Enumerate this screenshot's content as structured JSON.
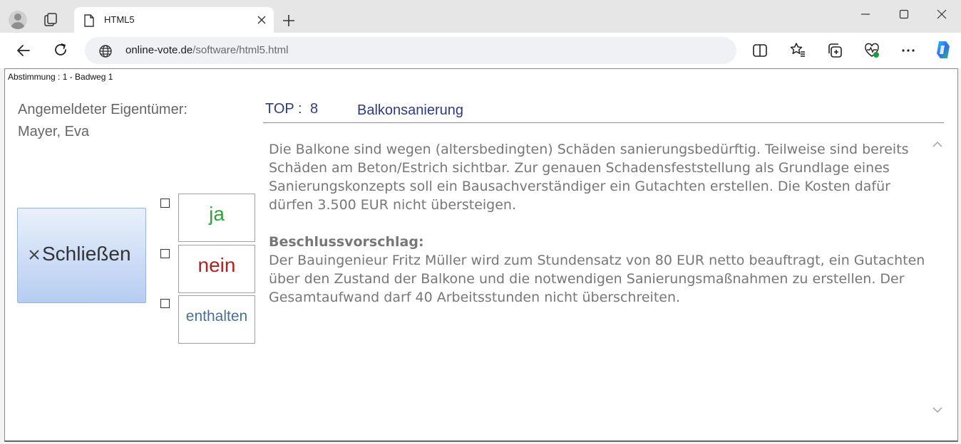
{
  "browser": {
    "tab_title": "HTML5",
    "url_host": "online-vote.de",
    "url_path": "/software/html5.html"
  },
  "page": {
    "header": "Abstimmung : 1 - Badweg 1",
    "owner_label": "Angemeldeter Eigentümer:",
    "owner_name": "Mayer, Eva",
    "close_label": "Schließen",
    "votes": {
      "yes": "ja",
      "no": "nein",
      "abstain": "enthalten"
    },
    "top_label": "TOP :",
    "top_number": "8",
    "top_title": "Balkonsanierung",
    "description": "Die Balkone sind wegen (altersbedingten) Schäden sanierungsbedürftig. Teilweise sind bereits Schäden am Beton/Estrich sichtbar. Zur genauen Schadensfeststellung als Grundlage eines Sanierungskonzepts soll ein Bausachverständiger ein Gutachten erstellen. Die Kosten dafür dürfen 3.500 EUR nicht übersteigen.",
    "proposal_heading": "Beschlussvorschlag:",
    "proposal_text": "Der Bauingenieur Fritz Müller wird zum Stundensatz von 80 EUR netto beauftragt, ein Gutachten über den Zustand der Balkone und die notwendigen Sanierungsmaßnahmen zu erstellen. Der Gesamtaufwand darf 40 Arbeitsstunden nicht überschreiten."
  },
  "colors": {
    "yes": "#2fa43b",
    "no": "#b22222",
    "abstain": "#4a6f96",
    "heading": "#2e3a86"
  },
  "icons": [
    "avatar-icon",
    "workspaces-icon",
    "page-icon",
    "close-icon",
    "plus-icon",
    "minimize-icon",
    "maximize-icon",
    "back-icon",
    "refresh-icon",
    "globe-icon",
    "split-screen-icon",
    "favorites-icon",
    "collections-icon",
    "browser-essentials-icon",
    "more-icon",
    "copilot-icon",
    "chevron-up-icon",
    "chevron-down-icon"
  ]
}
